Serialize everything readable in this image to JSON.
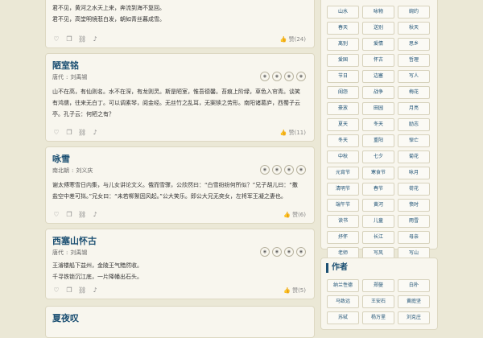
{
  "poems": [
    {
      "title": "",
      "dynasty": "",
      "author": "",
      "lines": [
        "君不见，黄河之水天上来，奔流到海不复回。",
        "君不见，高堂明镜悲白发，朝如青丝暮成雪。"
      ],
      "likes": "赞(24)"
    },
    {
      "title": "陋室铭",
      "dynasty": "唐代",
      "author": "刘禹锡",
      "lines": [
        "山不在高，有仙则名。水不在深，有龙则灵。斯是陋室，惟吾德馨。苔痕上阶绿，草色入帘青。谈笑",
        "有鸿儒，往来无白丁。可以调素琴，阅金经。无丝竹之乱耳，无案牍之劳形。南阳诸葛庐，西蜀子云",
        "亭。孔子云：何陋之有？"
      ],
      "likes": "赞(11)"
    },
    {
      "title": "咏雪",
      "dynasty": "南北朝",
      "author": "刘义庆",
      "lines": [
        "谢太傅寒雪日内集，与儿女讲论文义。俄而雪骤，公欣然曰：“白雪纷纷何所似？”兄子胡儿曰：“撒",
        "盐空中差可拟。”兄女曰：“未若柳絮因风起。”公大笑乐。即公大兄无奕女，左将军王凝之妻也。"
      ],
      "likes": "赞(6)"
    },
    {
      "title": "西塞山怀古",
      "dynasty": "唐代",
      "author": "刘禹锡",
      "lines": [
        "王濬楼船下益州，金陵王气黯然收。",
        "千寻铁锁沉江底，一片降幡出石头。"
      ],
      "likes": "赞(5)"
    },
    {
      "title": "夏夜叹",
      "dynasty": "",
      "author": "",
      "lines": [],
      "likes": ""
    }
  ],
  "card_buttons": [
    "◉",
    "◉",
    "◉",
    "◉"
  ],
  "tool_icons": [
    "heart-icon",
    "copy-icon",
    "link-icon",
    "sound-icon"
  ],
  "topics": [
    "山水",
    "咏物",
    "婉约",
    "春天",
    "送别",
    "秋天",
    "离别",
    "爱情",
    "思乡",
    "爱国",
    "怀古",
    "哲理",
    "节日",
    "边塞",
    "写人",
    "闺怨",
    "战争",
    "梅花",
    "豪放",
    "田园",
    "月亮",
    "夏天",
    "冬天",
    "励志",
    "冬天",
    "重阳",
    "悼亡",
    "中秋",
    "七夕",
    "菊花",
    "元宵节",
    "寒食节",
    "咏月",
    "清明节",
    "春节",
    "荷花",
    "端午节",
    "黄河",
    "愤时",
    "读书",
    "儿童",
    "雨雪",
    "抒怀",
    "长江",
    "母亲",
    "老师",
    "写风",
    "写山"
  ],
  "authors_title": "作者",
  "authors": [
    "纳兰性德",
    "郑燮",
    "白朴",
    "马致远",
    "王安石",
    "黄庭坚",
    "苏轼",
    "杨万里",
    "刘克庄"
  ]
}
